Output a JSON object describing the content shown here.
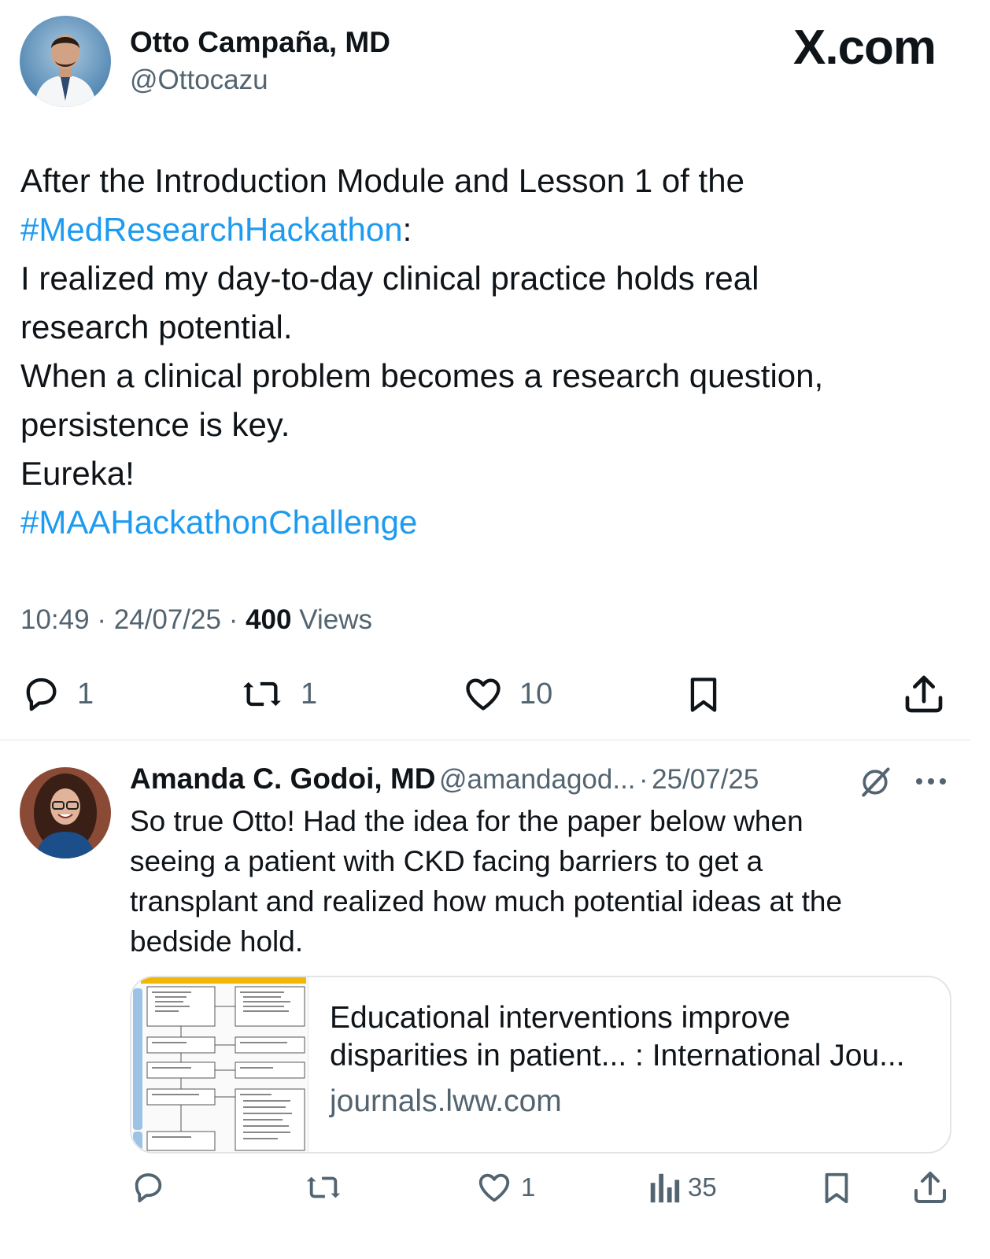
{
  "main_post": {
    "author_name": "Otto Campaña, MD",
    "author_handle": "@Ottocazu",
    "site_logo": "X.com",
    "text_lines": [
      {
        "text": "After the Introduction Module and Lesson 1 of the"
      },
      {
        "link": "#MedResearchHackathon",
        "text": ":"
      },
      {
        "text": "I realized my day-to-day clinical practice holds real"
      },
      {
        "text": "research potential."
      },
      {
        "text": "When a clinical problem becomes a research question,"
      },
      {
        "text": "persistence is key."
      },
      {
        "text": "Eureka!"
      },
      {
        "link": "#MAAHackathonChallenge",
        "text": ""
      }
    ],
    "time": "10:49",
    "date": "24/07/25",
    "views_count": "400",
    "views_label": "Views",
    "sep": "·",
    "actions": {
      "replies": "1",
      "reposts": "1",
      "likes": "10"
    }
  },
  "reply": {
    "author_name": "Amanda C. Godoi, MD",
    "author_handle": "@amandagod...",
    "sep": "·",
    "date": "25/07/25",
    "text_lines": [
      "So true Otto! Had the idea for the paper below when",
      "seeing a patient with CKD facing barriers to get a",
      "transplant and realized how much potential ideas at the",
      "bedside hold."
    ],
    "card": {
      "title_lines": [
        "Educational interventions improve",
        "disparities in patient... : International Jou..."
      ],
      "domain": "journals.lww.com"
    },
    "actions": {
      "replies": "",
      "reposts": "",
      "likes": "1",
      "views": "35"
    }
  },
  "icons": [
    "comment-icon",
    "repost-icon",
    "heart-icon",
    "bookmark-icon",
    "share-icon",
    "grok-icon",
    "more-icon",
    "views-icon"
  ],
  "colors": {
    "link": "#1d9bf0",
    "text": "#0f1419",
    "muted": "#536471",
    "border": "#e1e5e8"
  }
}
